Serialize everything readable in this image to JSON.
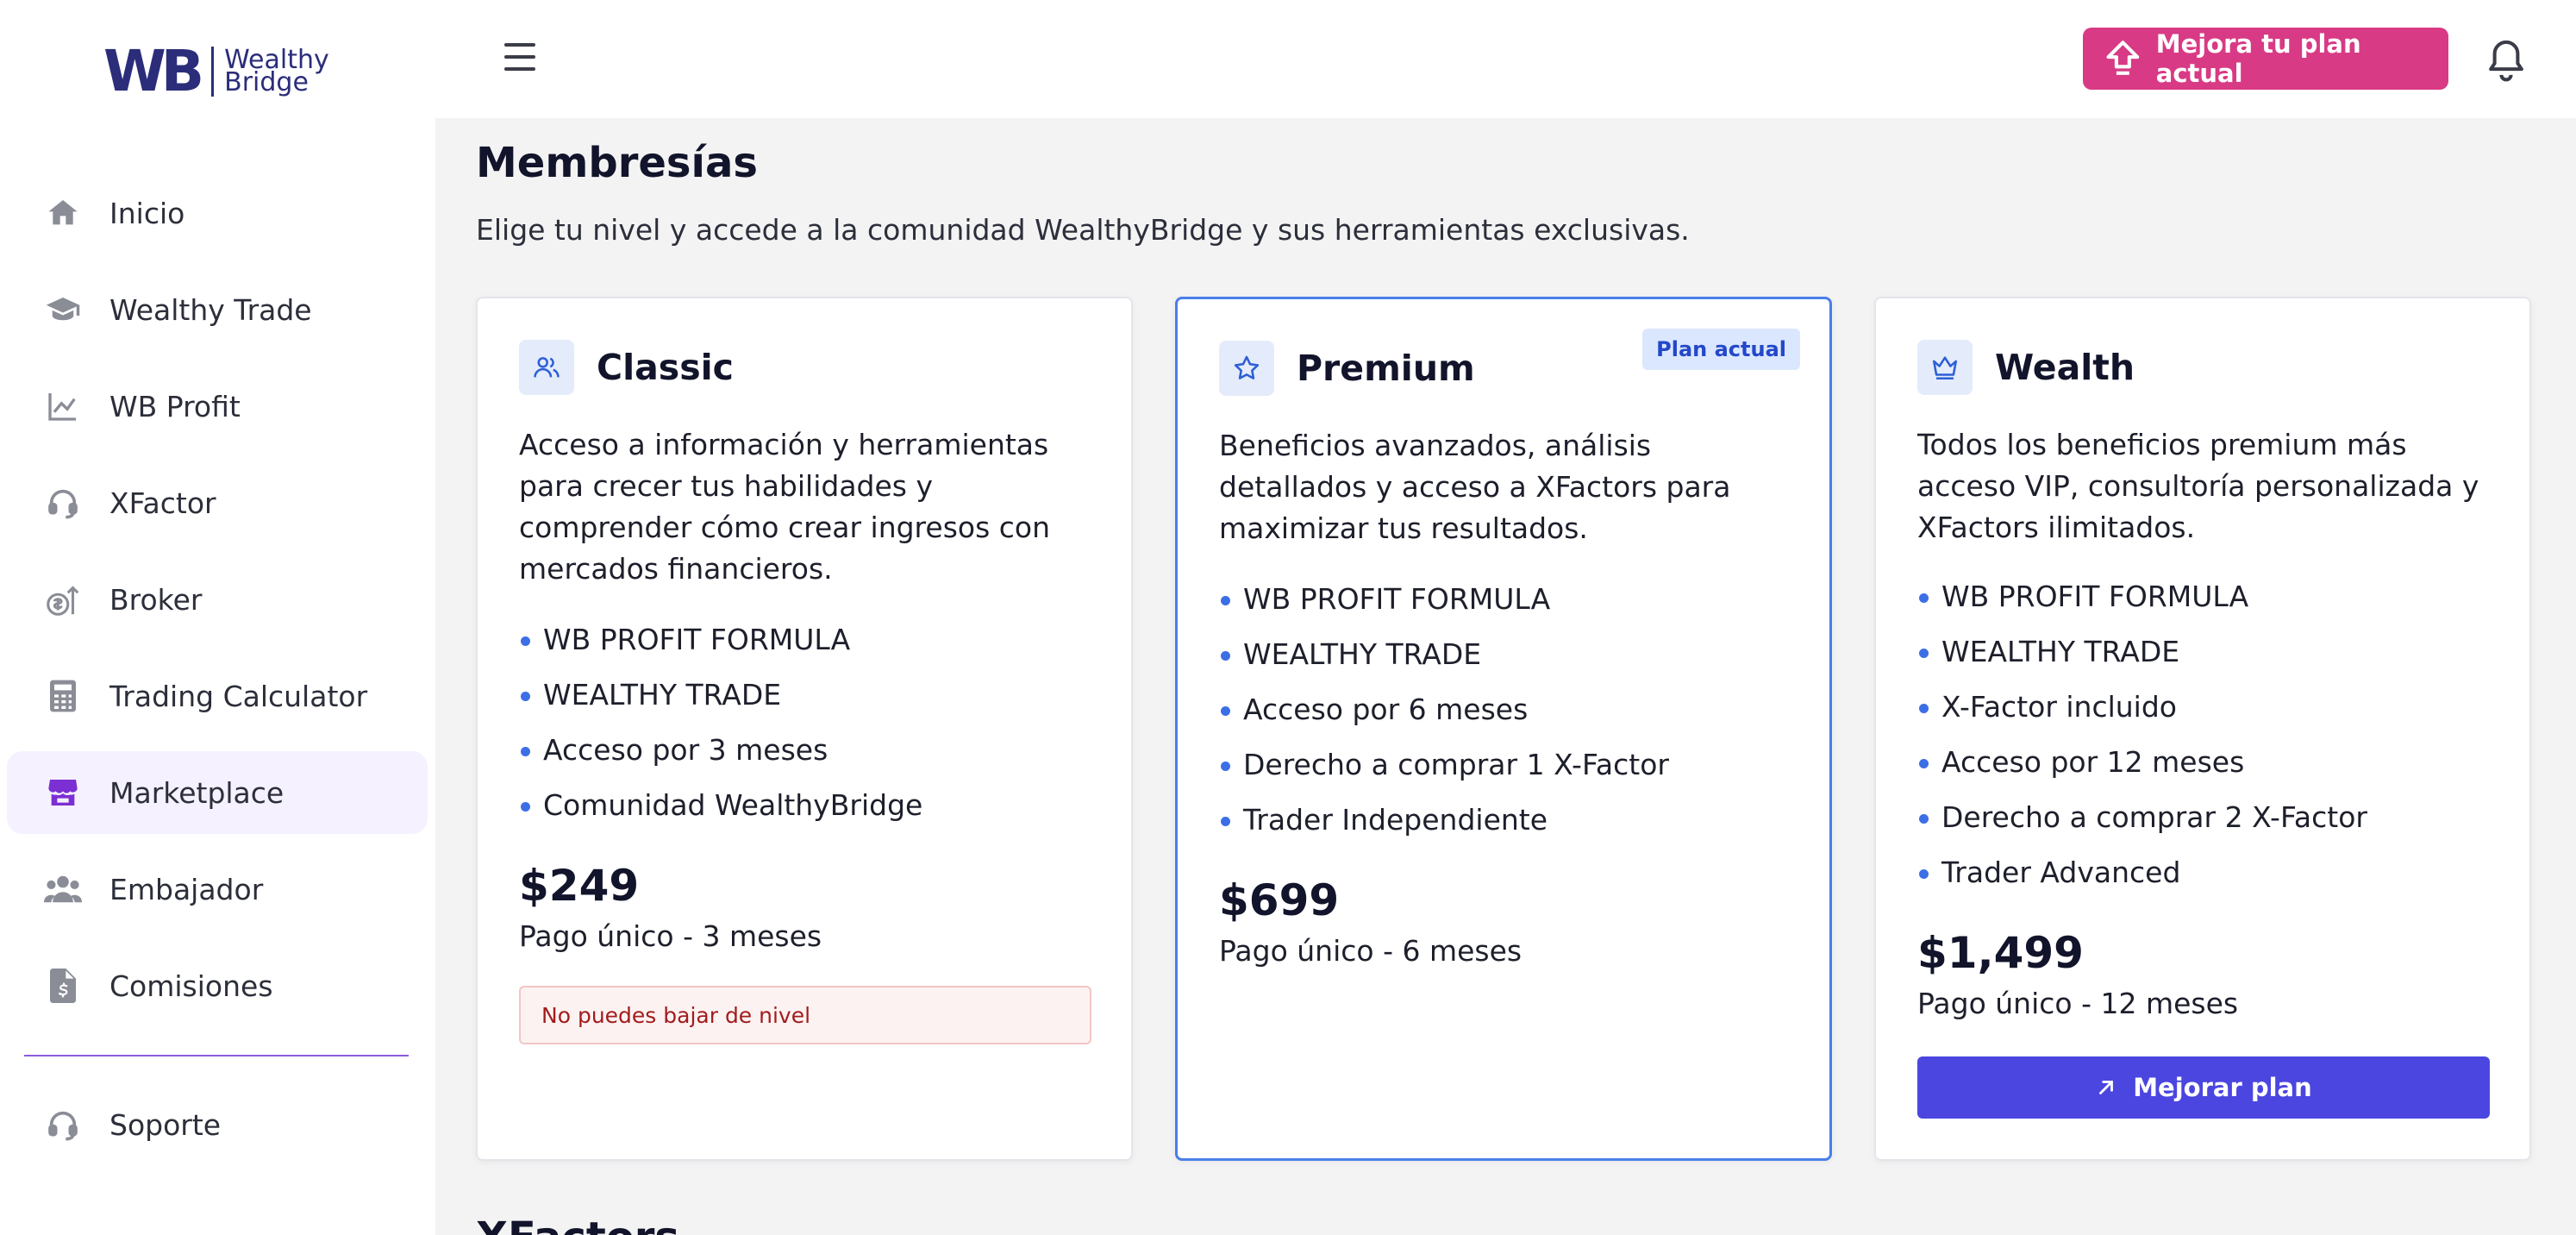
{
  "brand": {
    "mark": "WB",
    "line1": "Wealthy",
    "line2": "Bridge"
  },
  "sidebar": {
    "items": [
      {
        "label": "Inicio",
        "icon": "home-icon"
      },
      {
        "label": "Wealthy Trade",
        "icon": "graduation-cap-icon"
      },
      {
        "label": "WB Profit",
        "icon": "line-chart-icon"
      },
      {
        "label": "XFactor",
        "icon": "headset-icon"
      },
      {
        "label": "Broker",
        "icon": "money-bag-icon"
      },
      {
        "label": "Trading Calculator",
        "icon": "calculator-icon"
      },
      {
        "label": "Marketplace",
        "icon": "store-icon",
        "active": true
      },
      {
        "label": "Embajador",
        "icon": "users-icon"
      },
      {
        "label": "Comisiones",
        "icon": "invoice-dollar-icon"
      }
    ],
    "support": {
      "label": "Soporte",
      "icon": "headset-icon"
    }
  },
  "header": {
    "upgrade_label": "Mejora tu plan actual"
  },
  "main": {
    "title": "Membresías",
    "subtitle": "Elige tu nivel y accede a la comunidad WealthyBridge y sus herramientas exclusivas.",
    "next_section": "XFactors"
  },
  "plans": [
    {
      "name": "Classic",
      "icon": "users-outline-icon",
      "description": "Acceso a información y herramientas para crecer tus habilidades y comprender cómo crear ingresos con mercados financieros.",
      "features": [
        "WB PROFIT FORMULA",
        "WEALTHY TRADE",
        "Acceso por 3 meses",
        "Comunidad WealthyBridge"
      ],
      "price": "$249",
      "price_note": "Pago único - 3 meses",
      "notice": "No puedes bajar de nivel"
    },
    {
      "name": "Premium",
      "icon": "star-outline-icon",
      "badge": "Plan actual",
      "description": "Beneficios avanzados, análisis detallados y acceso a XFactors para maximizar tus resultados.",
      "features": [
        "WB PROFIT FORMULA",
        "WEALTHY TRADE",
        "Acceso por 6 meses",
        "Derecho a comprar 1 X-Factor",
        "Trader Independiente"
      ],
      "price": "$699",
      "price_note": "Pago único - 6 meses"
    },
    {
      "name": "Wealth",
      "icon": "crown-outline-icon",
      "description": "Todos los beneficios premium más acceso VIP, consultoría personalizada y XFactors ilimitados.",
      "features": [
        "WB PROFIT FORMULA",
        "WEALTHY TRADE",
        "X-Factor incluido",
        "Acceso por 12 meses",
        "Derecho a comprar 2 X-Factor",
        "Trader Advanced"
      ],
      "price": "$1,499",
      "price_note": "Pago único - 12 meses",
      "button": "Mejorar plan"
    }
  ],
  "colors": {
    "accent_pink": "#d83a85",
    "accent_indigo": "#4b46e0",
    "active_purple": "#7c2fd2",
    "current_border": "#4a7ee8"
  }
}
